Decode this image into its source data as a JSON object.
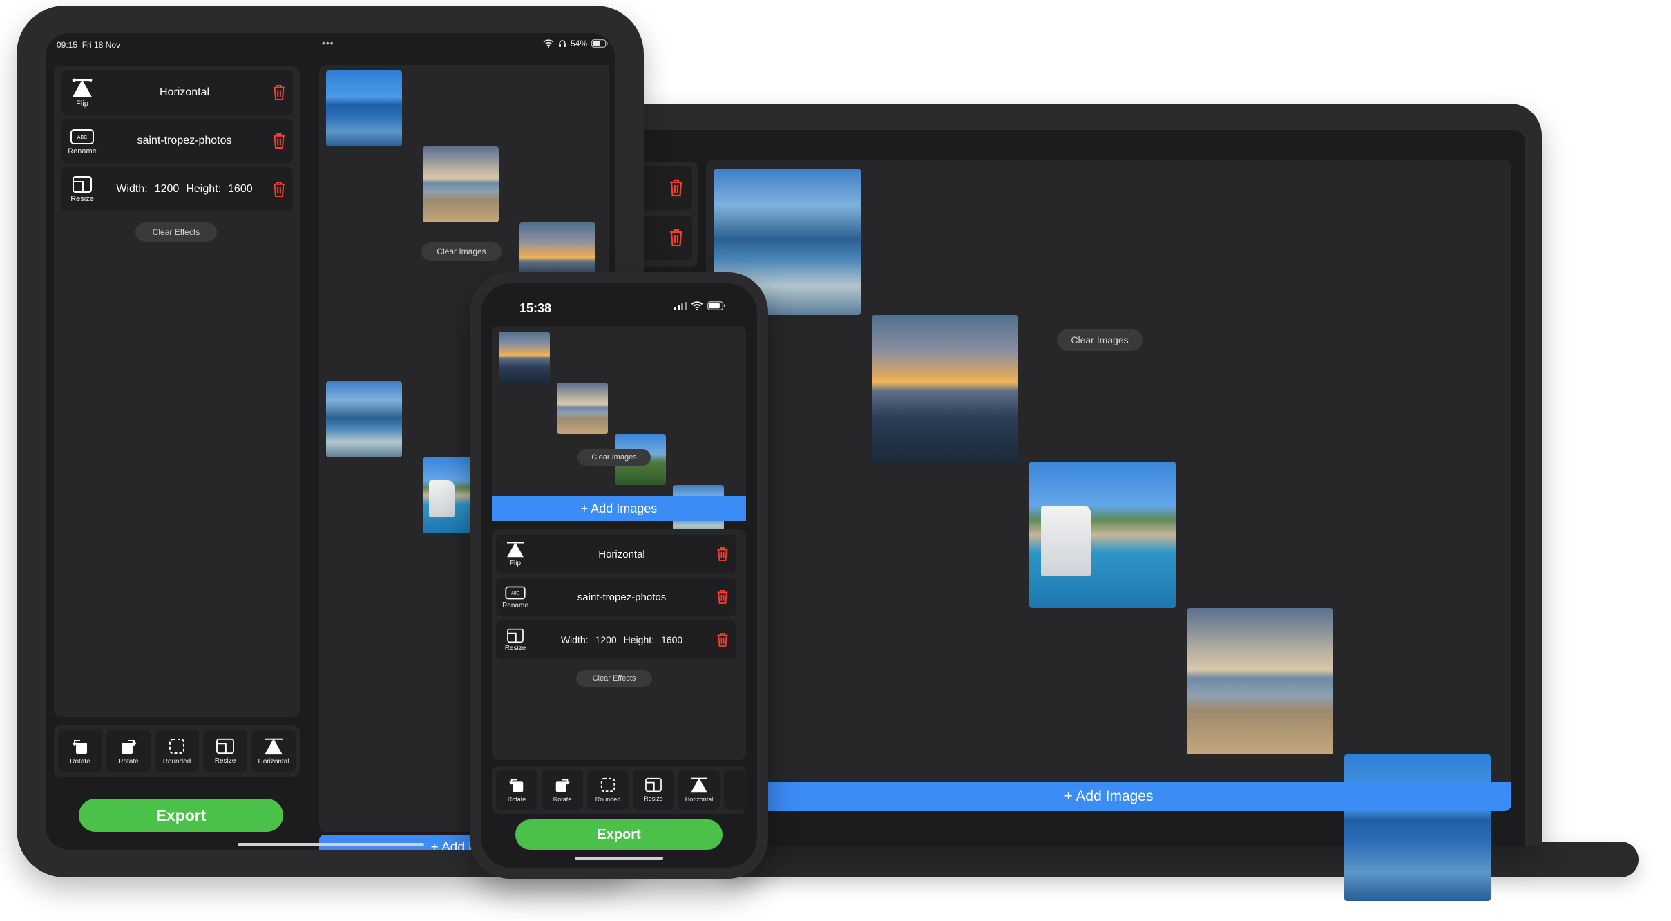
{
  "ipad": {
    "status": {
      "time": "09:15",
      "date": "Fri 18 Nov",
      "battery": "54%",
      "dots": "•••"
    },
    "effects": [
      {
        "icon": "flip-icon",
        "name": "Flip",
        "value": "Horizontal"
      },
      {
        "icon": "rename-icon",
        "name": "Rename",
        "value": "saint-tropez-photos"
      },
      {
        "icon": "resize-icon",
        "name": "Resize",
        "width_label": "Width:",
        "width": "1200",
        "height_label": "Height:",
        "height": "1600"
      }
    ],
    "clear_effects": "Clear Effects",
    "clear_images": "Clear Images",
    "tools": [
      "Rotate",
      "Rotate",
      "Rounded",
      "Resize",
      "Horizontal"
    ],
    "export": "Export",
    "add_images": "+ Add Images"
  },
  "mac": {
    "clear_images": "Clear Images",
    "add_images": "+ Add Images"
  },
  "phone": {
    "status": {
      "time": "15:38"
    },
    "clear_images": "Clear Images",
    "add_images": "+ Add Images",
    "effects": [
      {
        "icon": "flip-icon",
        "name": "Flip",
        "value": "Horizontal"
      },
      {
        "icon": "rename-icon",
        "name": "Rename",
        "value": "saint-tropez-photos"
      },
      {
        "icon": "resize-icon",
        "name": "Resize",
        "width_label": "Width:",
        "width": "1200",
        "height_label": "Height:",
        "height": "1600"
      }
    ],
    "clear_effects": "Clear Effects",
    "tools": [
      "Rotate",
      "Rotate",
      "Rounded",
      "Resize",
      "Horizontal"
    ],
    "export": "Export"
  },
  "colors": {
    "accent_blue": "#3c8cf5",
    "export_green": "#4cc14a",
    "trash_red": "#ff3b30"
  }
}
